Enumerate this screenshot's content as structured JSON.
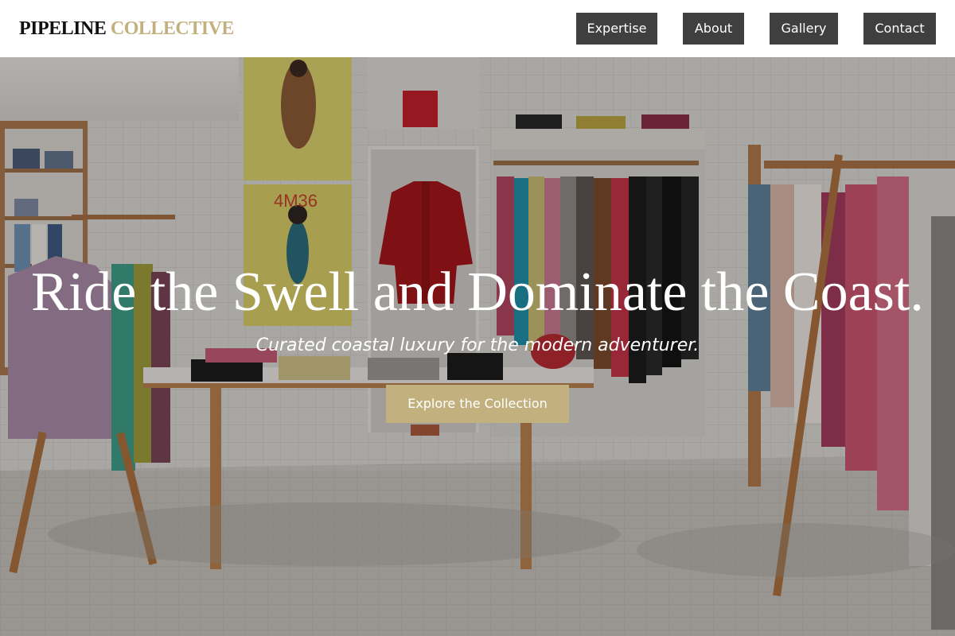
{
  "brand": {
    "word1": "PIPELINE",
    "word2": "COLLECTIVE"
  },
  "nav": {
    "items": [
      {
        "label": "Expertise"
      },
      {
        "label": "About"
      },
      {
        "label": "Gallery"
      },
      {
        "label": "Contact"
      }
    ]
  },
  "hero": {
    "headline": "Ride the Swell and Dominate the Coast.",
    "subheadline": "Curated coastal luxury for the modern adventurer.",
    "cta_label": "Explore the Collection",
    "poster_text": "4M36"
  },
  "colors": {
    "accent": "#c2b17f",
    "nav_button": "#3f3f40",
    "header_bg": "#ffffff"
  }
}
